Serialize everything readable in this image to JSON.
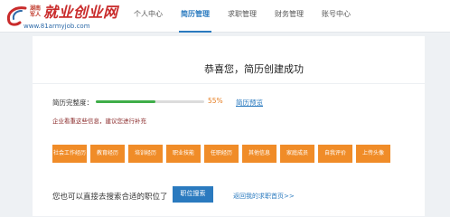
{
  "logo": {
    "small_text_line1": "湖南",
    "small_text_line2": "军人",
    "main_text": "就业创业网",
    "url_text": "www.81armyjob.com"
  },
  "nav": {
    "items": [
      {
        "label": "个人中心",
        "active": false
      },
      {
        "label": "简历管理",
        "active": true
      },
      {
        "label": "求职管理",
        "active": false
      },
      {
        "label": "财务管理",
        "active": false
      },
      {
        "label": "账号中心",
        "active": false
      }
    ]
  },
  "main": {
    "success_title": "恭喜您，简历创建成功",
    "completion_label": "简历完整度：",
    "completion_percent": 55,
    "completion_text": "55%",
    "preview_link": "简历预览",
    "hint": "企业看重这些信息，建议您进行补充",
    "sections": [
      "社会工作经历",
      "教育经历",
      "培训经历",
      "职业技能",
      "任职经历",
      "其他信息",
      "家庭成员",
      "自我评价",
      "上传头像"
    ],
    "search_prompt": "您也可以直接去搜索合适的职位了",
    "search_button": "职位搜索",
    "back_link": "返回我的求职首页>>"
  },
  "colors": {
    "accent_blue": "#2a7abf",
    "section_orange": "#f08c28",
    "progress_green": "#3fae49",
    "percent_orange": "#e67e22",
    "logo_red": "#c92b2b"
  }
}
